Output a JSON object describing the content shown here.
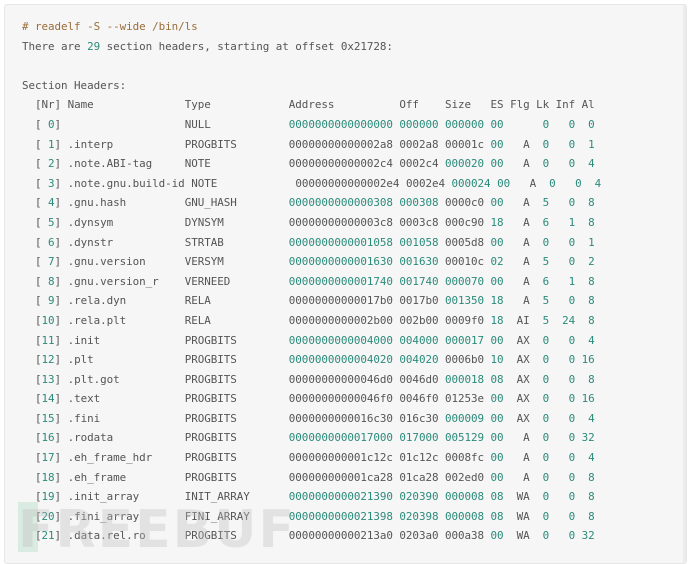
{
  "command_line": "# readelf -S --wide /bin/ls",
  "summary": {
    "prefix": "There are ",
    "count": "29",
    "suffix": " section headers, starting at offset 0x21728:"
  },
  "section_title": "Section Headers:",
  "header": {
    "nr": "[Nr]",
    "name": "Name",
    "type": "Type",
    "address": "Address",
    "off": "Off",
    "size": "Size",
    "es": "ES",
    "flg": "Flg",
    "lk": "Lk",
    "inf": "Inf",
    "al": "Al"
  },
  "sections": [
    {
      "nr": "0",
      "name": "",
      "type": "NULL",
      "address": "0000000000000000",
      "off": "000000",
      "size": "000000",
      "es": "00",
      "flg": "",
      "lk": "0",
      "inf": "0",
      "al": "0"
    },
    {
      "nr": "1",
      "name": ".interp",
      "type": "PROGBITS",
      "address": "00000000000002a8",
      "off": "0002a8",
      "size": "00001c",
      "es": "00",
      "flg": "A",
      "lk": "0",
      "inf": "0",
      "al": "1"
    },
    {
      "nr": "2",
      "name": ".note.ABI-tag",
      "type": "NOTE",
      "address": "00000000000002c4",
      "off": "0002c4",
      "size": "000020",
      "es": "00",
      "flg": "A",
      "lk": "0",
      "inf": "0",
      "al": "4"
    },
    {
      "nr": "3",
      "name": ".note.gnu.build-id",
      "type": "NOTE",
      "address": "00000000000002e4",
      "off": "0002e4",
      "size": "000024",
      "es": "00",
      "flg": "A",
      "lk": "0",
      "inf": "0",
      "al": "4"
    },
    {
      "nr": "4",
      "name": ".gnu.hash",
      "type": "GNU_HASH",
      "address": "0000000000000308",
      "off": "000308",
      "size": "0000c0",
      "es": "00",
      "flg": "A",
      "lk": "5",
      "inf": "0",
      "al": "8"
    },
    {
      "nr": "5",
      "name": ".dynsym",
      "type": "DYNSYM",
      "address": "00000000000003c8",
      "off": "0003c8",
      "size": "000c90",
      "es": "18",
      "flg": "A",
      "lk": "6",
      "inf": "1",
      "al": "8"
    },
    {
      "nr": "6",
      "name": ".dynstr",
      "type": "STRTAB",
      "address": "0000000000001058",
      "off": "001058",
      "size": "0005d8",
      "es": "00",
      "flg": "A",
      "lk": "0",
      "inf": "0",
      "al": "1"
    },
    {
      "nr": "7",
      "name": ".gnu.version",
      "type": "VERSYM",
      "address": "0000000000001630",
      "off": "001630",
      "size": "00010c",
      "es": "02",
      "flg": "A",
      "lk": "5",
      "inf": "0",
      "al": "2"
    },
    {
      "nr": "8",
      "name": ".gnu.version_r",
      "type": "VERNEED",
      "address": "0000000000001740",
      "off": "001740",
      "size": "000070",
      "es": "00",
      "flg": "A",
      "lk": "6",
      "inf": "1",
      "al": "8"
    },
    {
      "nr": "9",
      "name": ".rela.dyn",
      "type": "RELA",
      "address": "00000000000017b0",
      "off": "0017b0",
      "size": "001350",
      "es": "18",
      "flg": "A",
      "lk": "5",
      "inf": "0",
      "al": "8"
    },
    {
      "nr": "10",
      "name": ".rela.plt",
      "type": "RELA",
      "address": "0000000000002b00",
      "off": "002b00",
      "size": "0009f0",
      "es": "18",
      "flg": "AI",
      "lk": "5",
      "inf": "24",
      "al": "8"
    },
    {
      "nr": "11",
      "name": ".init",
      "type": "PROGBITS",
      "address": "0000000000004000",
      "off": "004000",
      "size": "000017",
      "es": "00",
      "flg": "AX",
      "lk": "0",
      "inf": "0",
      "al": "4"
    },
    {
      "nr": "12",
      "name": ".plt",
      "type": "PROGBITS",
      "address": "0000000000004020",
      "off": "004020",
      "size": "0006b0",
      "es": "10",
      "flg": "AX",
      "lk": "0",
      "inf": "0",
      "al": "16"
    },
    {
      "nr": "13",
      "name": ".plt.got",
      "type": "PROGBITS",
      "address": "00000000000046d0",
      "off": "0046d0",
      "size": "000018",
      "es": "08",
      "flg": "AX",
      "lk": "0",
      "inf": "0",
      "al": "8"
    },
    {
      "nr": "14",
      "name": ".text",
      "type": "PROGBITS",
      "address": "00000000000046f0",
      "off": "0046f0",
      "size": "01253e",
      "es": "00",
      "flg": "AX",
      "lk": "0",
      "inf": "0",
      "al": "16"
    },
    {
      "nr": "15",
      "name": ".fini",
      "type": "PROGBITS",
      "address": "0000000000016c30",
      "off": "016c30",
      "size": "000009",
      "es": "00",
      "flg": "AX",
      "lk": "0",
      "inf": "0",
      "al": "4"
    },
    {
      "nr": "16",
      "name": ".rodata",
      "type": "PROGBITS",
      "address": "0000000000017000",
      "off": "017000",
      "size": "005129",
      "es": "00",
      "flg": "A",
      "lk": "0",
      "inf": "0",
      "al": "32"
    },
    {
      "nr": "17",
      "name": ".eh_frame_hdr",
      "type": "PROGBITS",
      "address": "000000000001c12c",
      "off": "01c12c",
      "size": "0008fc",
      "es": "00",
      "flg": "A",
      "lk": "0",
      "inf": "0",
      "al": "4"
    },
    {
      "nr": "18",
      "name": ".eh_frame",
      "type": "PROGBITS",
      "address": "000000000001ca28",
      "off": "01ca28",
      "size": "002ed0",
      "es": "00",
      "flg": "A",
      "lk": "0",
      "inf": "0",
      "al": "8"
    },
    {
      "nr": "19",
      "name": ".init_array",
      "type": "INIT_ARRAY",
      "address": "0000000000021390",
      "off": "020390",
      "size": "000008",
      "es": "08",
      "flg": "WA",
      "lk": "0",
      "inf": "0",
      "al": "8"
    },
    {
      "nr": "20",
      "name": ".fini_array",
      "type": "FINI_ARRAY",
      "address": "0000000000021398",
      "off": "020398",
      "size": "000008",
      "es": "08",
      "flg": "WA",
      "lk": "0",
      "inf": "0",
      "al": "8"
    },
    {
      "nr": "21",
      "name": ".data.rel.ro",
      "type": "PROGBITS",
      "address": "00000000000213a0",
      "off": "0203a0",
      "size": "000a38",
      "es": "00",
      "flg": "WA",
      "lk": "0",
      "inf": "0",
      "al": "32"
    }
  ],
  "watermark": "FREEBUF",
  "colors": {
    "background": "#f6f6f6",
    "text": "#555555",
    "comment": "#9a6e3a",
    "number": "#2a8a7a"
  }
}
